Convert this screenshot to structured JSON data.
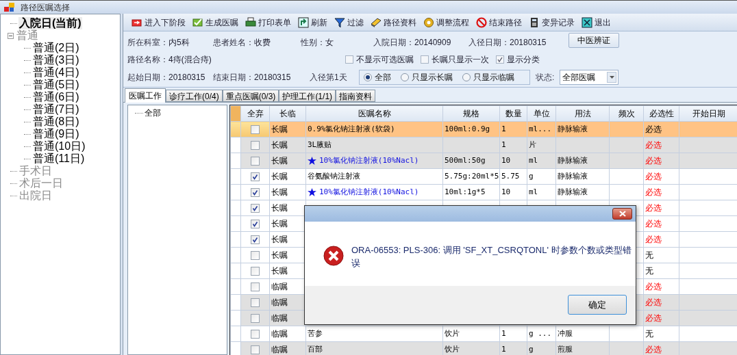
{
  "window": {
    "title": "路径医嘱选择"
  },
  "path_tree": [
    {
      "label": "入院日(当前)",
      "selected": true,
      "disabled": false
    },
    {
      "label": "普通",
      "selected": false,
      "disabled": true,
      "expanded": true,
      "children": [
        {
          "label": "普通(2日)",
          "selected": false,
          "disabled": false
        },
        {
          "label": "普通(3日)",
          "selected": false,
          "disabled": false
        },
        {
          "label": "普通(4日)",
          "selected": false,
          "disabled": false
        },
        {
          "label": "普通(5日)",
          "selected": false,
          "disabled": false
        },
        {
          "label": "普通(6日)",
          "selected": false,
          "disabled": false
        },
        {
          "label": "普通(7日)",
          "selected": false,
          "disabled": false
        },
        {
          "label": "普通(8日)",
          "selected": false,
          "disabled": false
        },
        {
          "label": "普通(9日)",
          "selected": false,
          "disabled": false
        },
        {
          "label": "普通(10日)",
          "selected": false,
          "disabled": false
        },
        {
          "label": "普通(11日)",
          "selected": false,
          "disabled": false
        }
      ]
    },
    {
      "label": "手术日",
      "selected": false,
      "disabled": true
    },
    {
      "label": "术后一日",
      "selected": false,
      "disabled": true
    },
    {
      "label": "出院日",
      "selected": false,
      "disabled": true
    }
  ],
  "toolbar": [
    "进入下阶段",
    "生成医嘱",
    "打印表单",
    "刷新",
    "过滤",
    "路径资料",
    "调整流程",
    "结束路径",
    "变异记录",
    "退出"
  ],
  "info": {
    "row_1": [
      {
        "label": "所在科室：",
        "value": "内5科"
      },
      {
        "label": "患者姓名：",
        "value": "收费"
      },
      {
        "label": "性别：",
        "value": "女"
      },
      {
        "label": "入院日期：",
        "value": "20140909"
      },
      {
        "label": "入径日期：",
        "value": "20180315"
      }
    ],
    "tcm_button": "中医辨证",
    "row_2": [
      {
        "label": "路径名称：",
        "value": "4痔(混合痔)"
      }
    ],
    "options": [
      {
        "label": "不显示可选医嘱",
        "checked": false
      },
      {
        "label": "长嘱只显示一次",
        "checked": false
      },
      {
        "label": "显示分类",
        "checked": true
      }
    ],
    "row_3": [
      {
        "label": "起始日期：",
        "value": "20180315"
      },
      {
        "label": "结束日期：",
        "value": "20180315"
      },
      {
        "label": "入径第1天"
      }
    ],
    "filters": [
      {
        "label": "全部",
        "selected": true
      },
      {
        "label": "只显示长嘱",
        "selected": false
      },
      {
        "label": "只显示临嘱",
        "selected": false
      }
    ],
    "status_label": "状态:",
    "status_value": "全部医嘱"
  },
  "tabs": [
    {
      "label": "医嘱工作",
      "selected": true
    },
    {
      "label": "诊疗工作(0/4)",
      "selected": false
    },
    {
      "label": "重点医嘱(0/3)",
      "selected": false
    },
    {
      "label": "护理工作(1/1)",
      "selected": false
    },
    {
      "label": "指南资料",
      "selected": false
    }
  ],
  "category_tree": [
    {
      "label": "全部"
    }
  ],
  "table": {
    "columns": [
      "全弃",
      "长临",
      "医嘱名称",
      "规格",
      "数量",
      "单位",
      "用法",
      "频次",
      "必选性",
      "开始日期"
    ],
    "rows": [
      {
        "selected": true,
        "abandon": false,
        "type": "长嘱",
        "name": "0.9%氯化钠注射液(软袋)",
        "starred": false,
        "spec": "100ml:0.9g",
        "qty": "1",
        "unit": "ml...",
        "usage": "静脉输液",
        "required": "必选",
        "mandatory": true
      },
      {
        "selected": false,
        "shaded": true,
        "abandon": false,
        "type": "长嘱",
        "name": "3L腋贴",
        "starred": false,
        "qty": "1",
        "unit": "片",
        "required": "必选",
        "mandatory": true
      },
      {
        "selected": false,
        "shaded": true,
        "abandon": false,
        "type": "长嘱",
        "name": "10%氯化钠注射液(10%Nacl)",
        "starred": true,
        "spec": "500ml:50g",
        "qty": "10",
        "unit": "ml",
        "usage": "静脉输液",
        "required": "必选",
        "mandatory": true
      },
      {
        "selected": false,
        "shaded": false,
        "abandon": true,
        "type": "长嘱",
        "name": "谷氨酸钠注射液",
        "starred": false,
        "spec": "5.75g:20ml*5",
        "qty": "5.75",
        "unit": "g",
        "usage": "静脉输液",
        "required": "必选",
        "mandatory": true
      },
      {
        "selected": false,
        "shaded": false,
        "abandon": true,
        "type": "长嘱",
        "name": "10%氯化钠注射液(10%Nacl)",
        "starred": true,
        "spec": "10ml:1g*5",
        "qty": "10",
        "unit": "ml",
        "usage": "静脉输液",
        "required": "必选",
        "mandatory": true
      },
      {
        "selected": false,
        "shaded": false,
        "abandon": true,
        "type": "长嘱",
        "starred": false,
        "required": "必选",
        "mandatory": true
      },
      {
        "selected": false,
        "shaded": false,
        "abandon": true,
        "type": "长嘱",
        "starred": false,
        "required": "必选",
        "mandatory": true
      },
      {
        "selected": false,
        "shaded": false,
        "abandon": true,
        "type": "长嘱",
        "starred": false,
        "required": "必选",
        "mandatory": true
      },
      {
        "selected": false,
        "shaded": false,
        "abandon": false,
        "type": "长嘱",
        "starred": false,
        "required": "无",
        "mandatory": false
      },
      {
        "selected": false,
        "shaded": false,
        "abandon": false,
        "type": "长嘱",
        "starred": false,
        "required": "无",
        "mandatory": false
      },
      {
        "selected": false,
        "shaded": false,
        "abandon": false,
        "type": "临嘱",
        "starred": false,
        "required": "必选",
        "mandatory": true
      },
      {
        "selected": false,
        "shaded": true,
        "abandon": false,
        "type": "临嘱",
        "starred": false,
        "required": "必选",
        "mandatory": true
      },
      {
        "selected": false,
        "shaded": true,
        "abandon": false,
        "type": "临嘱",
        "starred": false,
        "required": "必选",
        "mandatory": true
      },
      {
        "selected": false,
        "shaded": false,
        "abandon": false,
        "type": "临嘱",
        "name": "苦参",
        "starred": false,
        "spec": "饮片",
        "qty": "1",
        "unit": "g ...",
        "usage": "冲服",
        "required": "无",
        "mandatory": false
      },
      {
        "selected": false,
        "shaded": true,
        "abandon": false,
        "type": "临嘱",
        "name": "百部",
        "starred": false,
        "spec": "饮片",
        "qty": "1",
        "unit": "g",
        "usage": "煎服",
        "required": "必选",
        "mandatory": true
      }
    ]
  },
  "dialog": {
    "message": "ORA-06553: PLS-306: 调用 'SF_XT_CSRQTONL' 时参数个数或类型错误",
    "ok_button": "确定"
  }
}
